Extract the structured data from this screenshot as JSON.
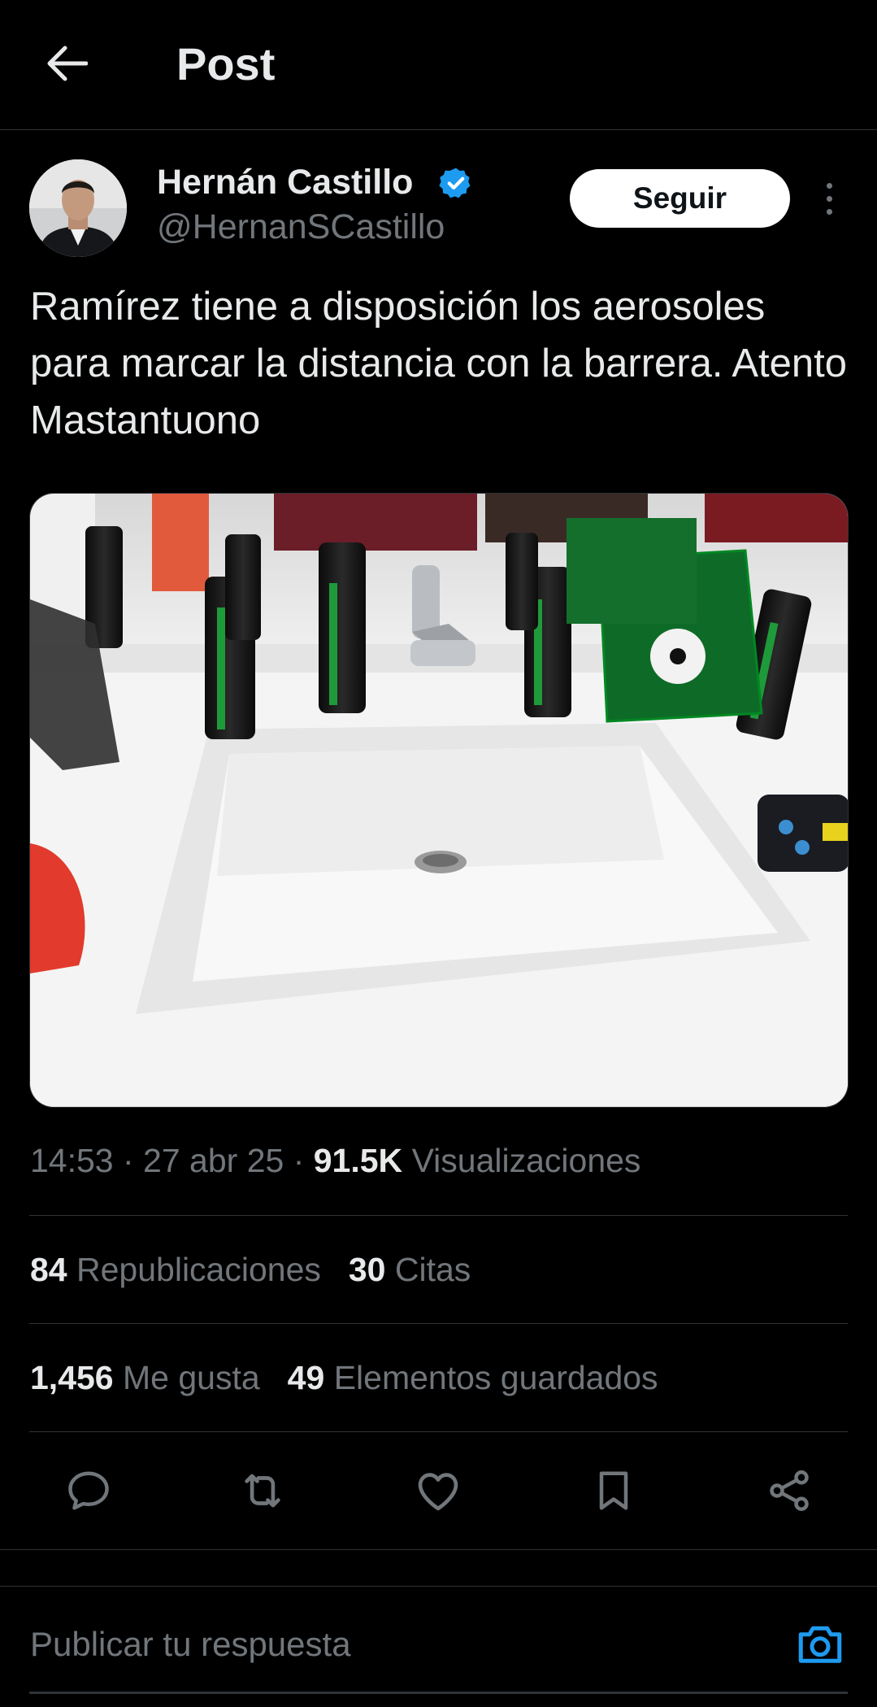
{
  "header": {
    "title": "Post",
    "back_icon": "arrow-left-icon"
  },
  "author": {
    "display_name": "Hernán Castillo",
    "handle": "@HernanSCastillo",
    "verified_icon": "verified-badge-icon",
    "follow_label": "Seguir",
    "more_icon": "more-vertical-icon"
  },
  "post": {
    "text": "Ramírez tiene a disposición los aerosoles para marcar la distancia con la barrera. Atento Mastantuono",
    "time": "14:53",
    "sep1": " · ",
    "date": "27 abr 25",
    "sep2": " · ",
    "views_count": "91.5K",
    "views_label": "Visualizaciones"
  },
  "stats": {
    "reposts_count": "84",
    "reposts_label": "Republicaciones",
    "quotes_count": "30",
    "quotes_label": "Citas",
    "likes_count": "1,456",
    "likes_label": "Me gusta",
    "bookmarks_count": "49",
    "bookmarks_label": "Elementos guardados"
  },
  "actions": [
    "reply-icon",
    "repost-icon",
    "like-icon",
    "bookmark-icon",
    "share-icon"
  ],
  "reply": {
    "placeholder": "Publicar tu respuesta",
    "camera_icon": "camera-icon"
  },
  "colors": {
    "background": "#000000",
    "primary_text": "#e7e9ea",
    "secondary_text": "#71767b",
    "accent": "#1d9bf0",
    "divider": "#2f3336"
  }
}
